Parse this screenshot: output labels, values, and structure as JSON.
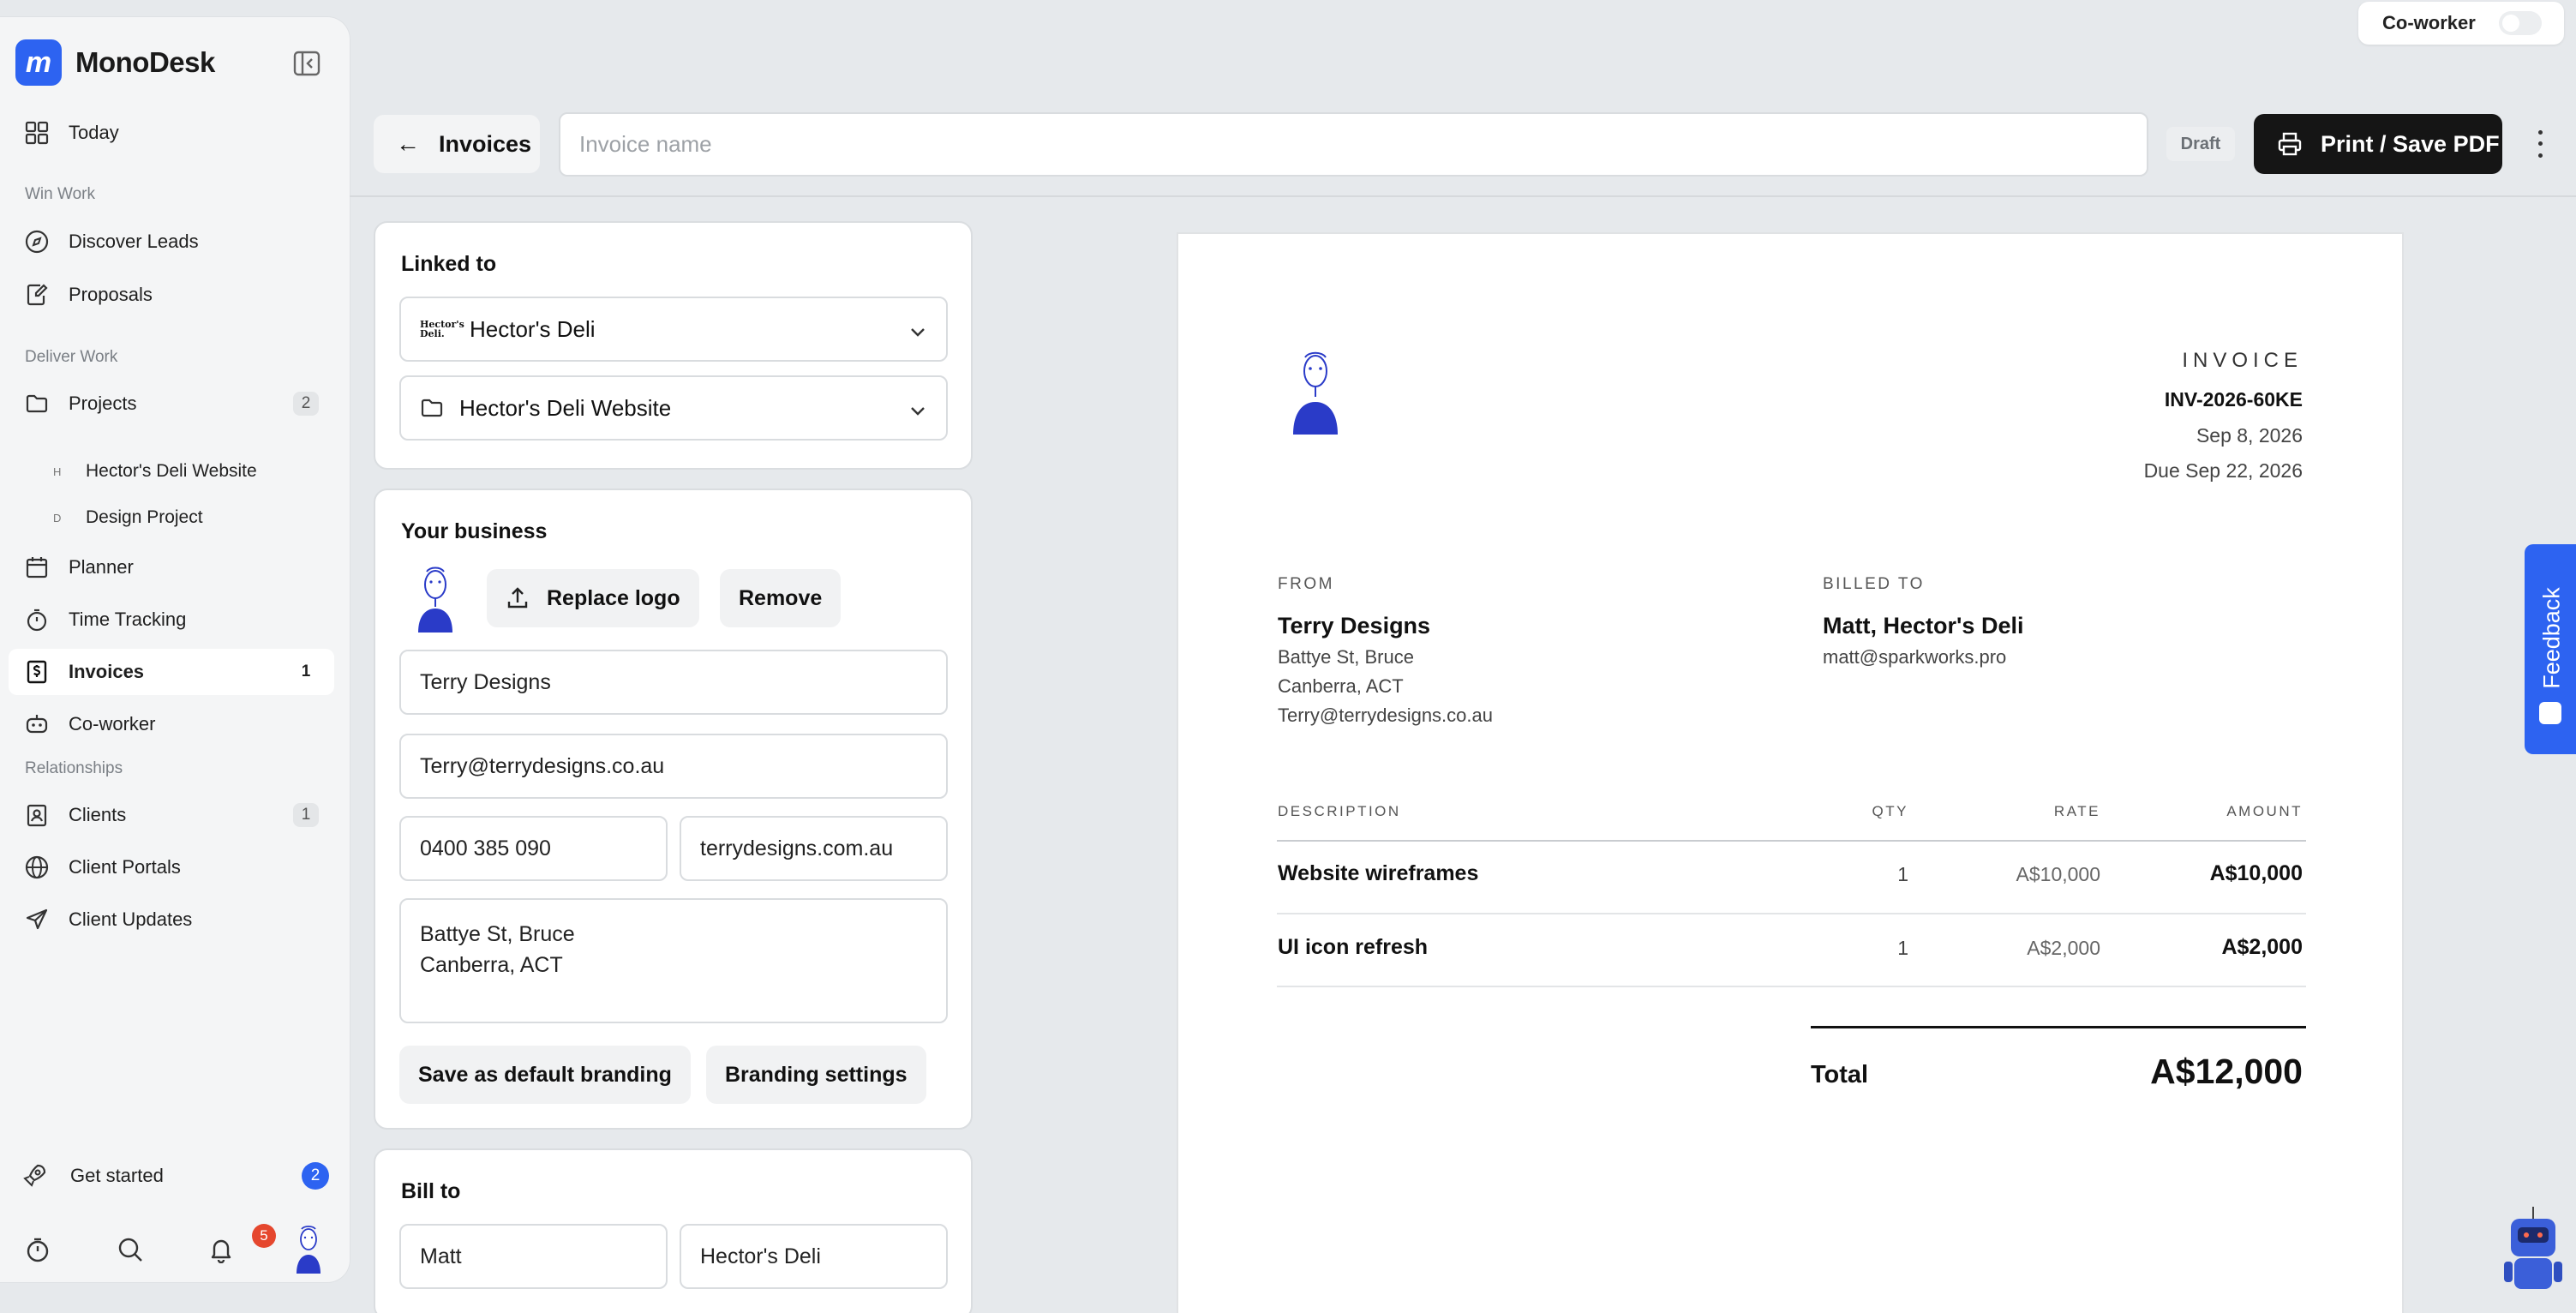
{
  "app": {
    "name": "MonoDesk"
  },
  "sidebar": {
    "today": "Today",
    "sections": {
      "win_work": "Win Work",
      "deliver_work": "Deliver Work",
      "relationships": "Relationships"
    },
    "items": {
      "discover_leads": "Discover Leads",
      "proposals": "Proposals",
      "projects": {
        "label": "Projects",
        "count": "2"
      },
      "sub_projects": [
        {
          "initial": "H",
          "label": "Hector's Deli Website"
        },
        {
          "initial": "D",
          "label": "Design Project"
        }
      ],
      "planner": "Planner",
      "time_tracking": "Time Tracking",
      "invoices": {
        "label": "Invoices",
        "count": "1"
      },
      "coworker": "Co-worker",
      "clients": {
        "label": "Clients",
        "count": "1"
      },
      "client_portals": "Client Portals",
      "client_updates": "Client Updates"
    },
    "get_started": {
      "label": "Get started",
      "badge": "2"
    },
    "notifications_badge": "5"
  },
  "topbar": {
    "coworker_toggle": "Co-worker",
    "back_label": "Invoices",
    "name_placeholder": "Invoice name",
    "status": "Draft",
    "print_label": "Print / Save PDF"
  },
  "form": {
    "linked_to": {
      "title": "Linked to",
      "client": "Hector's Deli",
      "client_logo_text": "Hector's Deli.",
      "project": "Hector's Deli Website"
    },
    "business": {
      "title": "Your business",
      "replace_logo": "Replace logo",
      "remove": "Remove",
      "name": "Terry Designs",
      "email": "Terry@terrydesigns.co.au",
      "phone": "0400 385 090",
      "website": "terrydesigns.com.au",
      "address_line1": "Battye St, Bruce",
      "address_line2": "Canberra, ACT",
      "save_default": "Save as default branding",
      "branding_settings": "Branding settings"
    },
    "bill_to": {
      "title": "Bill to",
      "first_name": "Matt",
      "company": "Hector's Deli"
    }
  },
  "invoice": {
    "heading": "INVOICE",
    "number": "INV-2026-60KE",
    "date": "Sep 8, 2026",
    "due": "Due Sep 22, 2026",
    "from": {
      "label": "FROM",
      "name": "Terry Designs",
      "address1": "Battye St, Bruce",
      "address2": "Canberra, ACT",
      "email": "Terry@terrydesigns.co.au"
    },
    "billed_to": {
      "label": "BILLED TO",
      "name": "Matt, Hector's Deli",
      "email": "matt@sparkworks.pro"
    },
    "columns": {
      "description": "DESCRIPTION",
      "qty": "QTY",
      "rate": "RATE",
      "amount": "AMOUNT"
    },
    "lines": [
      {
        "description": "Website wireframes",
        "qty": "1",
        "rate": "A$10,000",
        "amount": "A$10,000"
      },
      {
        "description": "UI icon refresh",
        "qty": "1",
        "rate": "A$2,000",
        "amount": "A$2,000"
      }
    ],
    "total_label": "Total",
    "total": "A$12,000"
  },
  "feedback": {
    "label": "Feedback"
  },
  "colors": {
    "accent": "#2d63f1",
    "dark_button": "#151515",
    "notif": "#e5472e",
    "background": "#e6e9ec"
  }
}
